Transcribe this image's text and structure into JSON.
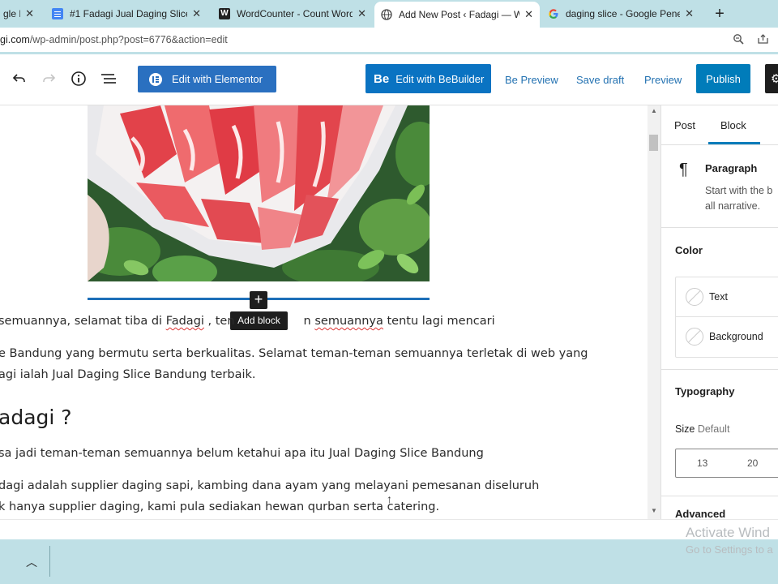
{
  "browser": {
    "tabs": [
      {
        "title": "gle D",
        "icon": "docs-icon"
      },
      {
        "title": "#1 Fadagi Jual Daging Slice E",
        "icon": "docs-icon"
      },
      {
        "title": "WordCounter - Count Words",
        "icon": "wordcounter-icon"
      },
      {
        "title": "Add New Post ‹ Fadagi — W",
        "icon": "globe-icon"
      },
      {
        "title": "daging slice - Google Penelu",
        "icon": "google-icon"
      }
    ],
    "url_host": "gi.com",
    "url_path": "/wp-admin/post.php?post=6776&action=edit",
    "wordcounter_favicon": "W"
  },
  "toolbar": {
    "elementor_label": "Edit with Elementor",
    "bebuilder_logo": "Be",
    "bebuilder_label": "Edit with BeBuilder",
    "be_preview": "Be Preview",
    "save_draft": "Save draft",
    "preview": "Preview",
    "publish": "Publish"
  },
  "editor": {
    "add_block_tooltip": "Add block",
    "p1_a": "semuannya, selamat tiba di ",
    "p1_b": "Fadagi",
    "p1_c": " , ten",
    "p1_d": "n ",
    "p1_e": "semuannya",
    "p1_f": " tentu lagi mencari",
    "p2_line1": "e Bandung yang bermutu serta berkualitas. Selamat teman-teman semuannya terletak di web yang",
    "p2_line2": "agi  ialah Jual Daging Slice Bandung terbaik.",
    "heading": "adagi ?",
    "p3": "sa jadi teman-teman semuannya belum ketahui apa itu Jual Daging Slice Bandung",
    "p4_line1": "dagi  adalah  supplier daging sapi, kambing dana ayam yang melayani pemesanan diseluruh",
    "p4_line2": "k hanya supplier daging, kami pula sediakan hewan qurban serta catering."
  },
  "sidebar": {
    "tab_post": "Post",
    "tab_block": "Block",
    "block_name": "Paragraph",
    "block_desc_1": "Start with the b",
    "block_desc_2": "all narrative.",
    "color_title": "Color",
    "color_text": "Text",
    "color_background": "Background",
    "typography_title": "Typography",
    "size_label": "Size",
    "size_value": "Default",
    "size_options": [
      "13",
      "20"
    ],
    "advanced_title": "Advanced"
  },
  "os": {
    "watermark_line1": "Activate Wind",
    "watermark_line2": "Go to Settings to a"
  },
  "colors": {
    "primary_blue": "#007cba",
    "elementor_blue": "#2a70c0",
    "tab_bar": "#bfe0e6"
  }
}
